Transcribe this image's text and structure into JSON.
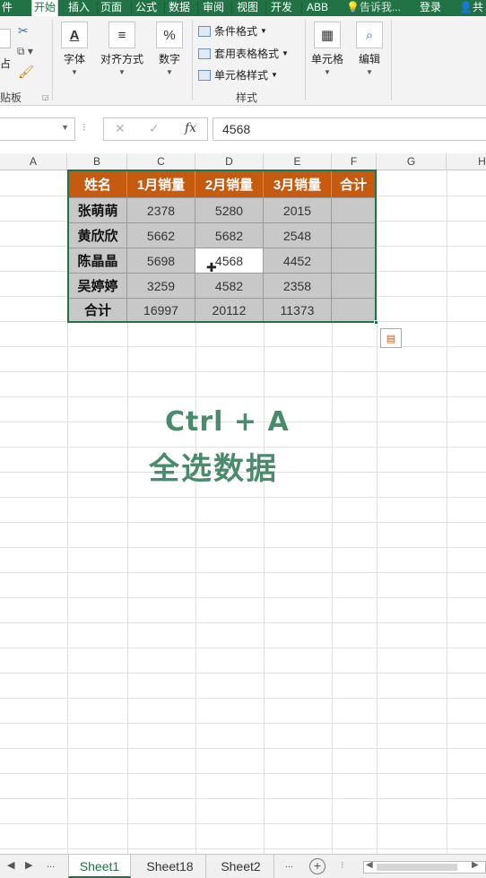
{
  "ribbon_tabs": [
    "件",
    "开始",
    "插入",
    "页面",
    "公式",
    "数据",
    "审阅",
    "视图",
    "开发",
    "ABB",
    "告诉我...",
    "登录",
    "共"
  ],
  "active_tab": "开始",
  "ribbon": {
    "clipboard_partial": "贴板",
    "paste_partial": "占",
    "font_label": "字体",
    "align_label": "对齐方式",
    "number_label": "数字",
    "conditional_format": "条件格式",
    "table_format": "套用表格格式",
    "cell_style": "单元格样式",
    "styles_group": "样式",
    "cells_label": "单元格",
    "edit_label": "编辑",
    "percent_glyph": "%"
  },
  "formula_bar": {
    "name_box": "",
    "value": "4568",
    "cancel": "✕",
    "enter": "✓",
    "fx": "fx",
    "dots": "⁝"
  },
  "columns": [
    "A",
    "B",
    "C",
    "D",
    "E",
    "F",
    "G",
    "H"
  ],
  "table": {
    "headers": [
      "姓名",
      "1月销量",
      "2月销量",
      "3月销量",
      "合计"
    ],
    "rows": [
      [
        "张萌萌",
        "2378",
        "5280",
        "2015",
        ""
      ],
      [
        "黄欣欣",
        "5662",
        "5682",
        "2548",
        ""
      ],
      [
        "陈晶晶",
        "5698",
        "4568",
        "4452",
        ""
      ],
      [
        "吴婷婷",
        "3259",
        "4582",
        "2358",
        ""
      ],
      [
        "合计",
        "16997",
        "20112",
        "11373",
        ""
      ]
    ],
    "selected_cell_display": "4568"
  },
  "overlay": {
    "line1": "Ctrl + A",
    "line2": "全选数据"
  },
  "sheets": [
    "Sheet1",
    "Sheet18",
    "Sheet2"
  ],
  "active_sheet": "Sheet1",
  "sheet_nav": {
    "left": "◀",
    "right": "▶",
    "more": "...",
    "add": "+"
  },
  "colors": {
    "accent": "#217346",
    "header_fill": "#c55a11",
    "data_fill": "#c8c8c8",
    "overlay_text": "#4a8b6b"
  }
}
